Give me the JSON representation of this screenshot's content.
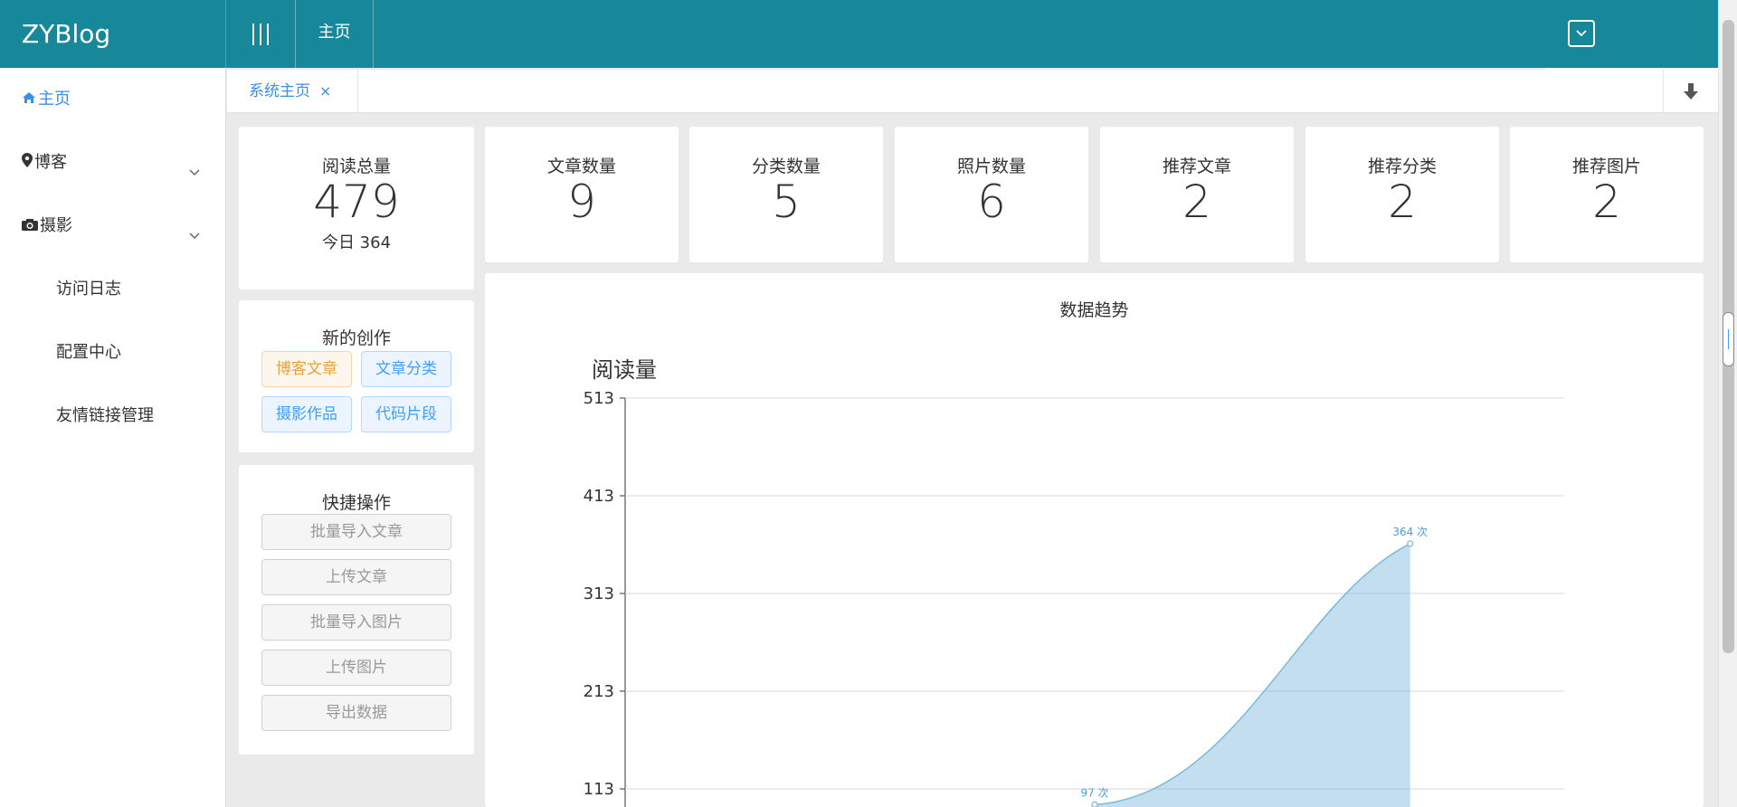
{
  "brand": "ZYBlog",
  "topbar": {
    "home_tab": "主页",
    "menu_icon": "menu-bars-icon",
    "right_icon": "chevron-box-icon"
  },
  "sidebar": {
    "items": [
      {
        "label": "主页",
        "icon": "home-icon",
        "active": true
      },
      {
        "label": "博客",
        "icon": "map-pin-icon",
        "expandable": true
      },
      {
        "label": "摄影",
        "icon": "camera-icon",
        "expandable": true
      },
      {
        "label": "访问日志"
      },
      {
        "label": "配置中心"
      },
      {
        "label": "友情链接管理"
      }
    ]
  },
  "tabs": [
    {
      "label": "系统主页",
      "close": "×"
    }
  ],
  "stats": {
    "read_total": {
      "label": "阅读总量",
      "value": "479",
      "today": "今日 364"
    },
    "cards": [
      {
        "label": "文章数量",
        "value": "9"
      },
      {
        "label": "分类数量",
        "value": "5"
      },
      {
        "label": "照片数量",
        "value": "6"
      },
      {
        "label": "推荐文章",
        "value": "2"
      },
      {
        "label": "推荐分类",
        "value": "2"
      },
      {
        "label": "推荐图片",
        "value": "2"
      }
    ]
  },
  "new_creation": {
    "title": "新的创作",
    "buttons": [
      "博客文章",
      "文章分类",
      "摄影作品",
      "代码片段"
    ]
  },
  "quick_actions": {
    "title": "快捷操作",
    "buttons": [
      "批量导入文章",
      "上传文章",
      "批量导入图片",
      "上传图片",
      "导出数据"
    ]
  },
  "colors": {
    "header": "#17889a",
    "accent": "#3a8ee6",
    "line": "#7ab8dc"
  },
  "chart_data": {
    "type": "area",
    "title": "数据趋势",
    "ylabel": "阅读量",
    "yticks": [
      513,
      413,
      313,
      213,
      113
    ],
    "ylim": [
      113,
      513
    ],
    "grid": true,
    "series": [
      {
        "points": [
          {
            "x": 0.5,
            "y": 97,
            "label": "97 次"
          },
          {
            "x": 0.836,
            "y": 364,
            "label": "364 次"
          }
        ]
      }
    ]
  }
}
